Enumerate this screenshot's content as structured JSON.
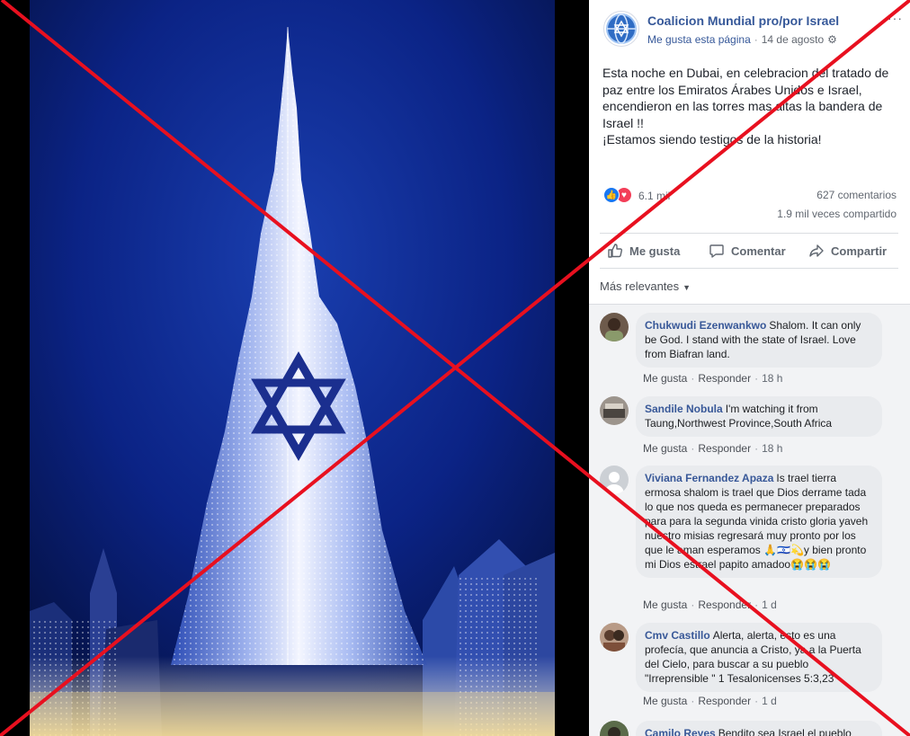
{
  "page": {
    "name": "Coalicion Mundial pro/por Israel",
    "like_page": "Me gusta esta página",
    "date": "14 de agosto",
    "more": "···"
  },
  "post": {
    "lines": [
      "Esta noche en Dubai, en celebracion del tratado de",
      "paz entre los Emiratos Árabes Unidos e Israel,",
      "encendieron en las torres mas altas la bandera de",
      "Israel !!",
      "¡Estamos siendo testigos de la historia!"
    ]
  },
  "stats": {
    "reactions": "6.1 mil",
    "comments": "627 comentarios",
    "shares": "1.9 mil veces compartido"
  },
  "actions": {
    "like": "Me gusta",
    "comment": "Comentar",
    "share": "Compartir"
  },
  "sort": {
    "label": "Más relevantes"
  },
  "comments": [
    {
      "name": "Chukwudi Ezenwankwo",
      "text": "Shalom. It can only be God. I stand with the state of Israel. Love from Biafran land.",
      "like": "Me gusta",
      "reply": "Responder",
      "time": "18 h"
    },
    {
      "name": "Sandile Nobula",
      "text": "I'm watching it from Taung,Northwest Province,South Africa",
      "like": "Me gusta",
      "reply": "Responder",
      "time": "18 h"
    },
    {
      "name": "Viviana Fernandez Apaza",
      "text": "Is trael tierra ermosa shalom is trael que Dios derrame tada lo que nos queda es permanecer preparados para para la segunda vinida cristo gloria yaveh nuestro misias regresará muy pronto por los que le aman esperamos 🙏🇮🇱💫y bien pronto mi Dios estrael papito amadoo😭😭😭",
      "like": "Me gusta",
      "reply": "Responder",
      "time": "1 d"
    },
    {
      "name": "Cmv Castillo",
      "text": "Alerta, alerta, esto es una profecía, que anuncia a Cristo, ya a la Puerta del Cielo, para buscar a su pueblo \"Irreprensible \" 1 Tesalonicenses 5:3,23",
      "like": "Me gusta",
      "reply": "Responder",
      "time": "1 d"
    },
    {
      "name": "Camilo Reyes",
      "text": "Bendito sea Israel el pueblo"
    }
  ],
  "colors": {
    "link": "#365899",
    "cross": "#e8101f",
    "star": "#1b2f8f",
    "sky": "#0a1d6b"
  }
}
